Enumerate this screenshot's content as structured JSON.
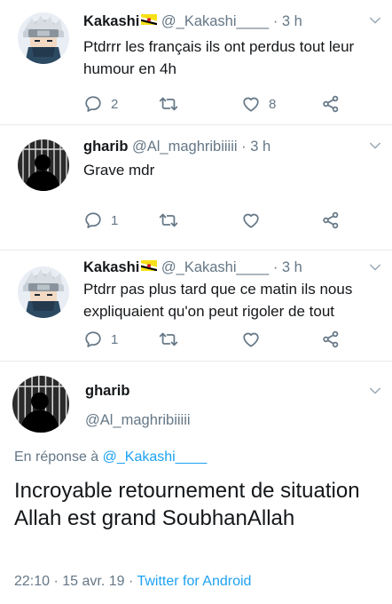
{
  "tweets": [
    {
      "author": "Kakashi",
      "handle": "@_Kakashi____",
      "dot": "·",
      "time": "3 h",
      "text": "Ptdrrr les français ils ont perdus tout leur humour en 4h",
      "replies": "2",
      "retweets": "",
      "likes": "8",
      "avatar_icon": "kakashi-avatar-icon",
      "flag_icon": "brunei-flag-icon"
    },
    {
      "author": "gharib",
      "handle": "@Al_maghribiiiii",
      "dot": "·",
      "time": "3 h",
      "text": "Grave mdr",
      "replies": "1",
      "retweets": "",
      "likes": "",
      "avatar_icon": "silhouette-bars-avatar-icon"
    },
    {
      "author": "Kakashi",
      "handle": "@_Kakashi____",
      "dot": "·",
      "time": "3 h",
      "text": "Ptdrr pas plus tard que ce matin ils nous expliquaient qu'on peut rigoler de tout",
      "replies": "1",
      "retweets": "",
      "likes": "",
      "avatar_icon": "kakashi-avatar-icon",
      "flag_icon": "brunei-flag-icon"
    }
  ],
  "focused": {
    "author": "gharib",
    "handle": "@Al_maghribiiiii",
    "reply_prefix": "En réponse à",
    "reply_to": "@_Kakashi____",
    "text": "Incroyable retournement de situation Allah est grand SoubhanAllah",
    "date": "22:10 · 15 avr. 19 ·",
    "source": "Twitter for Android"
  },
  "colors": {
    "text": "#14171a",
    "secondary": "#657786",
    "link": "#1da1f2",
    "divider": "#e6ecf0"
  }
}
